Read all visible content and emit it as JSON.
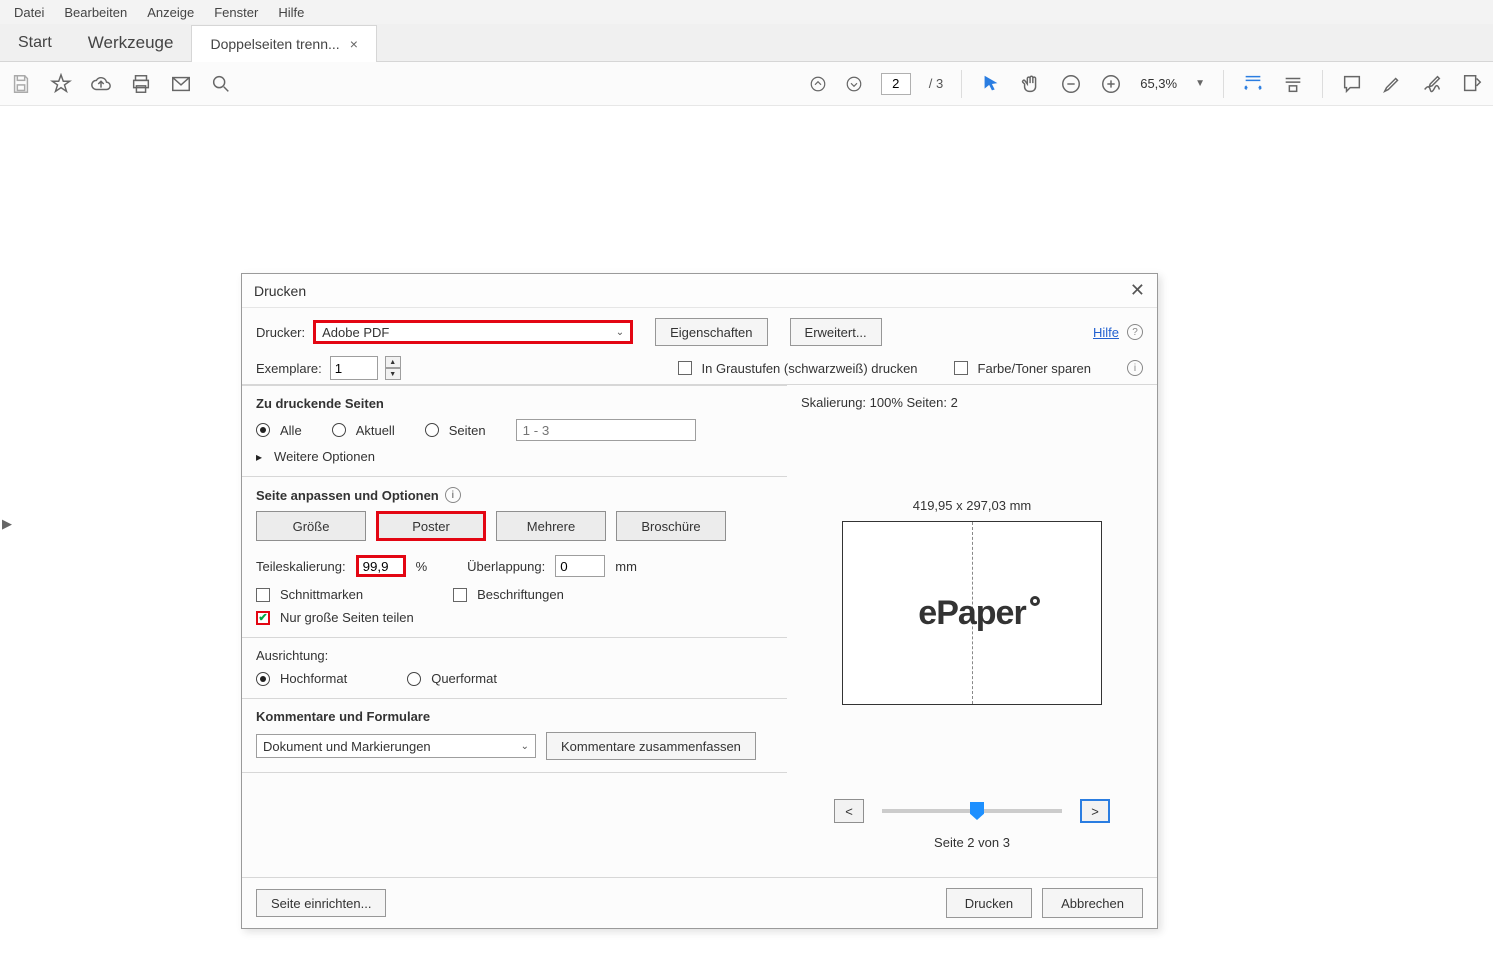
{
  "menubar": [
    "Datei",
    "Bearbeiten",
    "Anzeige",
    "Fenster",
    "Hilfe"
  ],
  "tabs": {
    "home": "Start",
    "tools": "Werkzeuge",
    "active": "Doppelseiten trenn..."
  },
  "toolbar": {
    "page_current": "2",
    "page_total": "/ 3",
    "zoom": "65,3%"
  },
  "dialog": {
    "title": "Drucken",
    "printer_label": "Drucker:",
    "printer_value": "Adobe PDF",
    "properties_btn": "Eigenschaften",
    "advanced_btn": "Erweitert...",
    "help_link": "Hilfe",
    "copies_label": "Exemplare:",
    "copies_value": "1",
    "grayscale_label": "In Graustufen (schwarzweiß) drucken",
    "save_toner_label": "Farbe/Toner sparen",
    "pages": {
      "title": "Zu druckende Seiten",
      "all": "Alle",
      "current": "Aktuell",
      "range_label": "Seiten",
      "range_placeholder": "1 - 3",
      "more": "Weitere Optionen"
    },
    "fit": {
      "title": "Seite anpassen und Optionen",
      "size": "Größe",
      "poster": "Poster",
      "multiple": "Mehrere",
      "booklet": "Broschüre",
      "tile_scale_label": "Teileskalierung:",
      "tile_scale_value": "99,9",
      "tile_scale_unit": "%",
      "overlap_label": "Überlappung:",
      "overlap_value": "0",
      "overlap_unit": "mm",
      "cut_marks": "Schnittmarken",
      "labels": "Beschriftungen",
      "split_large": "Nur große Seiten teilen"
    },
    "orientation": {
      "title": "Ausrichtung:",
      "portrait": "Hochformat",
      "landscape": "Querformat"
    },
    "comments": {
      "title": "Kommentare und Formulare",
      "selected": "Dokument und Markierungen",
      "summarize_btn": "Kommentare zusammenfassen"
    },
    "preview": {
      "scale_info": "Skalierung: 100% Seiten: 2",
      "dimensions": "419,95 x 297,03 mm",
      "logo_text": "ePaper",
      "prev": "<",
      "next": ">",
      "page_indicator": "Seite 2 von 3"
    },
    "page_setup_btn": "Seite einrichten...",
    "print_btn": "Drucken",
    "cancel_btn": "Abbrechen"
  }
}
